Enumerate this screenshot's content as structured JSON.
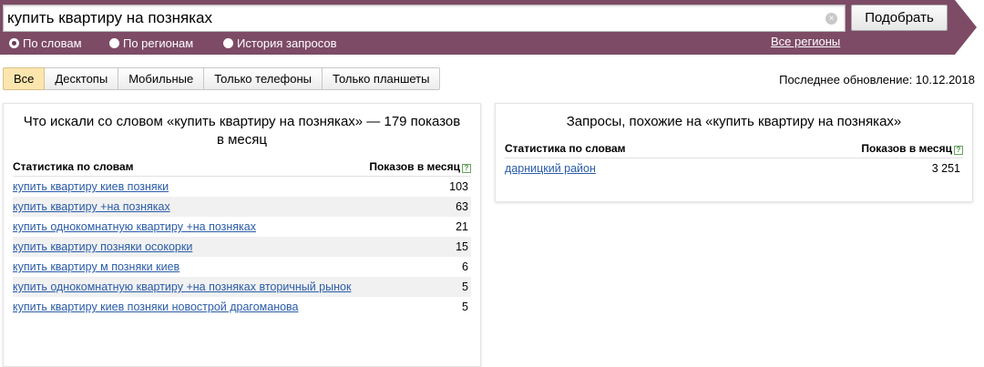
{
  "search": {
    "value": "купить квартиру на позняках",
    "clear_icon": "×",
    "button_label": "Подобрать"
  },
  "modes": [
    {
      "label": "По словам",
      "checked": true
    },
    {
      "label": "По регионам",
      "checked": false
    },
    {
      "label": "История запросов",
      "checked": false
    }
  ],
  "regions_link": "Все регионы",
  "tabs": [
    "Все",
    "Десктопы",
    "Мобильные",
    "Только телефоны",
    "Только планшеты"
  ],
  "last_update": "Последнее обновление: 10.12.2018",
  "colors": {
    "header_band": "#7d4b66",
    "active_tab": "#fde6ae",
    "link": "#2a5ca8"
  },
  "left": {
    "title": "Что искали со словом «купить квартиру на позняках» — 179 показов в месяц",
    "col_word": "Статистика по словам",
    "col_count": "Показов в месяц",
    "help_icon": "?",
    "rows": [
      {
        "text": "купить квартиру киев позняки",
        "count": "103"
      },
      {
        "text": "купить квартиру +на позняках",
        "count": "63"
      },
      {
        "text": "купить однокомнатную квартиру +на позняках",
        "count": "21"
      },
      {
        "text": "купить квартиру позняки осокорки",
        "count": "15"
      },
      {
        "text": "купить квартиру м позняки киев",
        "count": "6"
      },
      {
        "text": "купить однокомнатную квартиру +на позняках вторичный рынок",
        "count": "5"
      },
      {
        "text": "купить квартиру киев позняки новострой драгоманова",
        "count": "5"
      }
    ]
  },
  "right": {
    "title": "Запросы, похожие на «купить квартиру на позняках»",
    "col_word": "Статистика по словам",
    "col_count": "Показов в месяц",
    "help_icon": "?",
    "rows": [
      {
        "text": "дарницкий район",
        "count": "3 251"
      }
    ]
  }
}
